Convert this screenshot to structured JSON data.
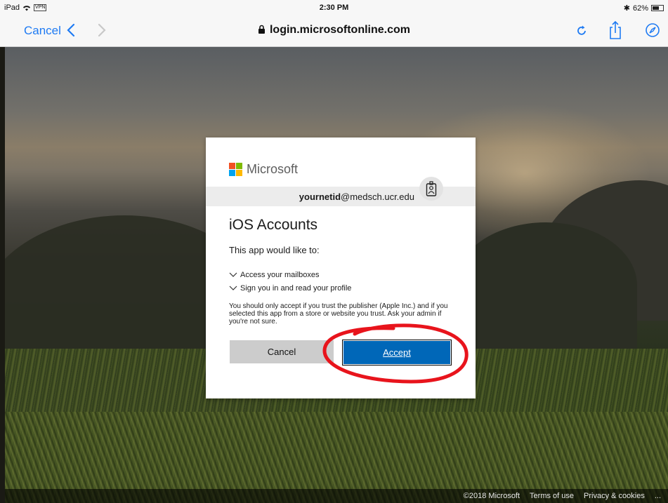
{
  "status_bar": {
    "device": "iPad",
    "vpn": "VPN",
    "time": "2:30 PM",
    "battery": "62%",
    "battery_level": 0.62
  },
  "nav": {
    "cancel_label": "Cancel",
    "url": "login.microsoftonline.com",
    "icons": [
      "back-chevron-icon",
      "forward-chevron-icon",
      "lock-icon",
      "reload-icon",
      "share-icon",
      "compass-icon"
    ],
    "accent_color": "#1f7bf3"
  },
  "dialog": {
    "brand": "Microsoft",
    "username": "yournetid",
    "domain": "@medsch.ucr.edu",
    "app_name": "iOS Accounts",
    "intro": "This app would like to:",
    "permissions": [
      "Access your mailboxes",
      "Sign you in and read your profile"
    ],
    "notice": "You should only accept if you trust the publisher (Apple Inc.) and if you selected this app from a store or website you trust. Ask your admin if you're not sure.",
    "cancel_label": "Cancel",
    "accept_label": "Accept",
    "accept_color": "#0067b8"
  },
  "footer": {
    "copyright": "©2018 Microsoft",
    "terms": "Terms of use",
    "privacy": "Privacy & cookies",
    "more": "..."
  },
  "annotation": {
    "color": "#e8141c"
  }
}
